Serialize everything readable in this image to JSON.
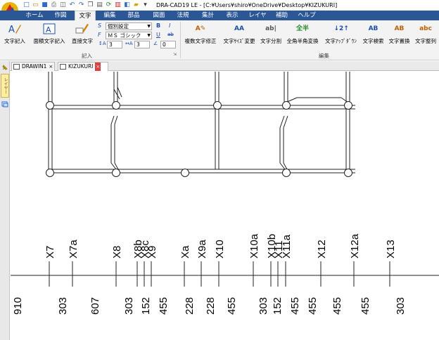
{
  "window": {
    "title": "DRA-CAD19 LE - [C:¥Users¥shiro¥OneDrive¥Desktop¥KIZUKURI]"
  },
  "quick_access": [
    {
      "name": "new-icon",
      "glyph": "□"
    },
    {
      "name": "open-icon",
      "glyph": "▭"
    },
    {
      "name": "save-icon",
      "glyph": "■"
    },
    {
      "name": "print-icon",
      "glyph": "⎙"
    },
    {
      "name": "preview-icon",
      "glyph": "◫"
    },
    {
      "name": "undo-icon",
      "glyph": "↶"
    },
    {
      "name": "redo-icon",
      "glyph": "↷"
    },
    {
      "name": "copy-icon",
      "glyph": "❐"
    },
    {
      "name": "paste-icon",
      "glyph": "▤"
    },
    {
      "name": "refresh-icon",
      "glyph": "⟳"
    },
    {
      "name": "book-icon",
      "glyph": "▥"
    },
    {
      "name": "layer-icon",
      "glyph": "◧"
    },
    {
      "name": "folder-icon",
      "glyph": "▰"
    },
    {
      "name": "menu-icon",
      "glyph": "▾"
    }
  ],
  "ribbon_tabs": [
    {
      "label": "ホーム",
      "active": false
    },
    {
      "label": "作図",
      "active": false
    },
    {
      "label": "文字",
      "active": true
    },
    {
      "label": "編集",
      "active": false
    },
    {
      "label": "部品",
      "active": false
    },
    {
      "label": "図面",
      "active": false
    },
    {
      "label": "法規",
      "active": false
    },
    {
      "label": "集計",
      "active": false
    },
    {
      "label": "表示",
      "active": false
    },
    {
      "label": "レイヤ",
      "active": false
    },
    {
      "label": "補助",
      "active": false
    },
    {
      "label": "ヘルプ",
      "active": false
    }
  ],
  "ribbon": {
    "group1": {
      "label": "記入",
      "buttons": [
        {
          "label": "文字記入",
          "icon": "text-write-icon"
        },
        {
          "label": "面積文字記入",
          "icon": "area-text-icon"
        },
        {
          "label": "直接文字",
          "icon": "direct-text-icon"
        }
      ],
      "style_combo": "個別設定",
      "font_combo": "ＭＳ ゴシック",
      "size_value": "3",
      "spacing_value": "3",
      "angle_value": "0",
      "style_glyph": "S",
      "font_glyph": "F",
      "bold_glyph": "B",
      "italic_glyph": "I",
      "underline_glyph": "U",
      "strike_glyph": "ab"
    },
    "group2": {
      "label": "編集",
      "buttons": [
        {
          "label": "複数文字修正",
          "icon": "multi-text-edit-icon"
        },
        {
          "label": "文字ｻｲｽﾞ変更",
          "icon": "text-size-icon"
        },
        {
          "label": "文字分割",
          "icon": "text-split-icon"
        },
        {
          "label": "全角半角変換",
          "icon": "width-convert-icon"
        },
        {
          "label": "文字ｱｯﾌﾟﾀﾞｳﾝ",
          "icon": "text-updown-icon"
        },
        {
          "label": "文字検索",
          "icon": "text-search-icon"
        },
        {
          "label": "文字置換",
          "icon": "text-replace-icon"
        },
        {
          "label": "文字整列",
          "icon": "text-align-icon"
        }
      ]
    }
  },
  "doc_tabs": [
    {
      "label": "DRAWIN1",
      "close": "×",
      "active": false
    },
    {
      "label": "KIZUKURI",
      "close": "×",
      "active": true
    }
  ],
  "side_panel": {
    "label": "レイヤー"
  },
  "drawing": {
    "grid_labels": [
      "X7",
      "X7a",
      "X8",
      "X8b",
      "X8c",
      "X9",
      "Xa",
      "X9a",
      "X10",
      "X10a",
      "X10b",
      "X11",
      "X11a",
      "X12",
      "X12a",
      "X13"
    ],
    "dimensions": [
      "910",
      "303",
      "607",
      "303",
      "152",
      "455",
      "228",
      "228",
      "455",
      "303",
      "152",
      "455",
      "455",
      "455",
      "455",
      "303"
    ]
  }
}
